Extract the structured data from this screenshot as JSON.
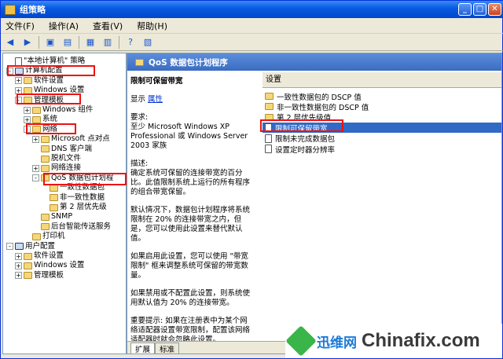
{
  "window": {
    "title": "组策略"
  },
  "menu": [
    "文件(F)",
    "操作(A)",
    "查看(V)",
    "帮助(H)"
  ],
  "tree": [
    {
      "label": "\"本地计算机\" 策略",
      "indent": 0,
      "expander": "",
      "icon": "page"
    },
    {
      "label": "计算机配置",
      "indent": 0,
      "expander": "-",
      "icon": "pc"
    },
    {
      "label": "软件设置",
      "indent": 1,
      "expander": "+",
      "icon": "folder"
    },
    {
      "label": "Windows 设置",
      "indent": 1,
      "expander": "+",
      "icon": "folder"
    },
    {
      "label": "管理模板",
      "indent": 1,
      "expander": "-",
      "icon": "folder"
    },
    {
      "label": "Windows 组件",
      "indent": 2,
      "expander": "+",
      "icon": "folder"
    },
    {
      "label": "系统",
      "indent": 2,
      "expander": "+",
      "icon": "folder"
    },
    {
      "label": "网络",
      "indent": 2,
      "expander": "-",
      "icon": "folder"
    },
    {
      "label": "Microsoft 点对点",
      "indent": 3,
      "expander": "+",
      "icon": "folder"
    },
    {
      "label": "DNS 客户端",
      "indent": 3,
      "expander": "",
      "icon": "folder"
    },
    {
      "label": "脱机文件",
      "indent": 3,
      "expander": "",
      "icon": "folder"
    },
    {
      "label": "网络连接",
      "indent": 3,
      "expander": "+",
      "icon": "folder"
    },
    {
      "label": "QoS 数据包计划程",
      "indent": 3,
      "expander": "-",
      "icon": "folder"
    },
    {
      "label": "一致性数据包",
      "indent": 4,
      "expander": "",
      "icon": "folder"
    },
    {
      "label": "非一致性数据",
      "indent": 4,
      "expander": "",
      "icon": "folder"
    },
    {
      "label": "第 2 层优先级",
      "indent": 4,
      "expander": "",
      "icon": "folder"
    },
    {
      "label": "SNMP",
      "indent": 3,
      "expander": "",
      "icon": "folder"
    },
    {
      "label": "后台智能传送服务",
      "indent": 3,
      "expander": "",
      "icon": "folder"
    },
    {
      "label": "打印机",
      "indent": 2,
      "expander": "",
      "icon": "folder"
    },
    {
      "label": "用户配置",
      "indent": 0,
      "expander": "-",
      "icon": "pc"
    },
    {
      "label": "软件设置",
      "indent": 1,
      "expander": "+",
      "icon": "folder"
    },
    {
      "label": "Windows 设置",
      "indent": 1,
      "expander": "+",
      "icon": "folder"
    },
    {
      "label": "管理模板",
      "indent": 1,
      "expander": "+",
      "icon": "folder"
    }
  ],
  "right": {
    "header": "QoS 数据包计划程序",
    "desc_title": "限制可保留带宽",
    "show": "显示",
    "properties": "属性",
    "req_title": "要求:",
    "req_text": "至少 Microsoft Windows XP Professional 或 Windows Server 2003 家族",
    "desc_label": "描述:",
    "desc_text": "确定系统可保留的连接带宽的百分比。此值限制系统上运行的所有程序的组合带宽保留。",
    "p2": "默认情况下，数据包计划程序将系统限制在 20% 的连接带宽之内，但是，您可以使用此设置来替代默认值。",
    "p3": "如果启用此设置，您可以使用 \"带宽限制\" 框来调整系统可保留的带宽数量。",
    "p4": "如果禁用或不配置此设置，则系统使用默认值为 20% 的连接带宽。",
    "p5": "重要提示: 如果在注册表中为某个网络适配器设置带宽限制，配置该网络适配器时就会忽略此设置。",
    "settings_header": "设置",
    "settings": [
      {
        "label": "一致性数据包的 DSCP 值",
        "icon": "folder"
      },
      {
        "label": "非一致性数据包的 DSCP 值",
        "icon": "folder"
      },
      {
        "label": "第 2 层优先级值",
        "icon": "folder"
      },
      {
        "label": "限制可保留带宽",
        "icon": "setting"
      },
      {
        "label": "限制未完成数据包",
        "icon": "setting"
      },
      {
        "label": "设置定时器分辨率",
        "icon": "setting"
      }
    ],
    "tabs": [
      "扩展",
      "标准"
    ]
  },
  "watermark": {
    "brand_cn": "迅维网",
    "brand_en": "Chinafix.com"
  }
}
